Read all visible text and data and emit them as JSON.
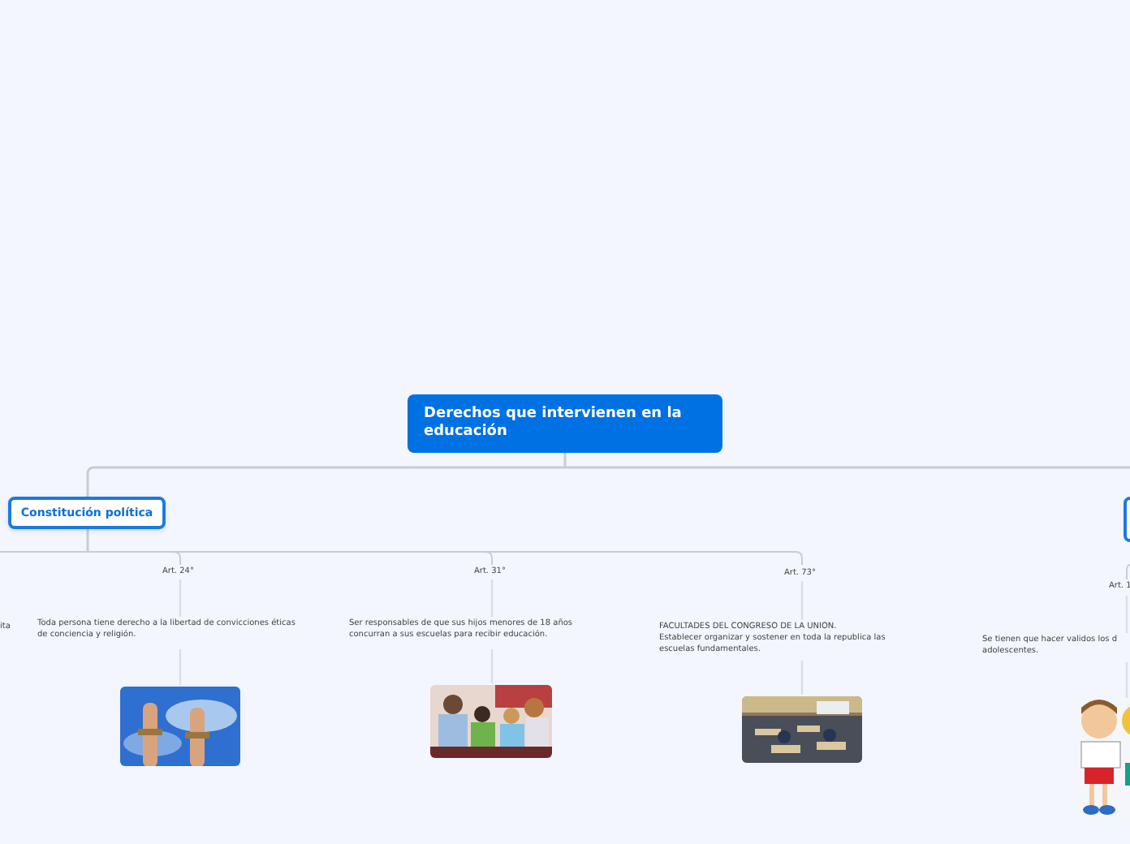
{
  "central_topic": "Derechos que intervienen en la educación",
  "main_topic": "Constitución política",
  "left_fragment": "ita",
  "articles": [
    {
      "label": "Art. 24°",
      "lines": [
        "Toda persona tiene derecho a la libertad de convicciones éticas",
        "de conciencia y religión."
      ],
      "kind": "picture"
    },
    {
      "label": "Art. 31°",
      "lines": [
        "Ser responsables de que sus hijos menores de 18 años",
        "concurran a sus escuelas para recibir educación."
      ],
      "kind": "picture"
    },
    {
      "label": "Art. 73°",
      "lines": [
        "FACULTADES DEL CONGRESO DE LA UNION.",
        "Establecer organizar y sostener en toda la republica las",
        "escuelas fundamentales."
      ],
      "kind": "picture"
    },
    {
      "label": "Art. 1",
      "lines": [
        "Se tienen que hacer validos los d",
        "adolescentes."
      ],
      "kind": "picture"
    }
  ]
}
